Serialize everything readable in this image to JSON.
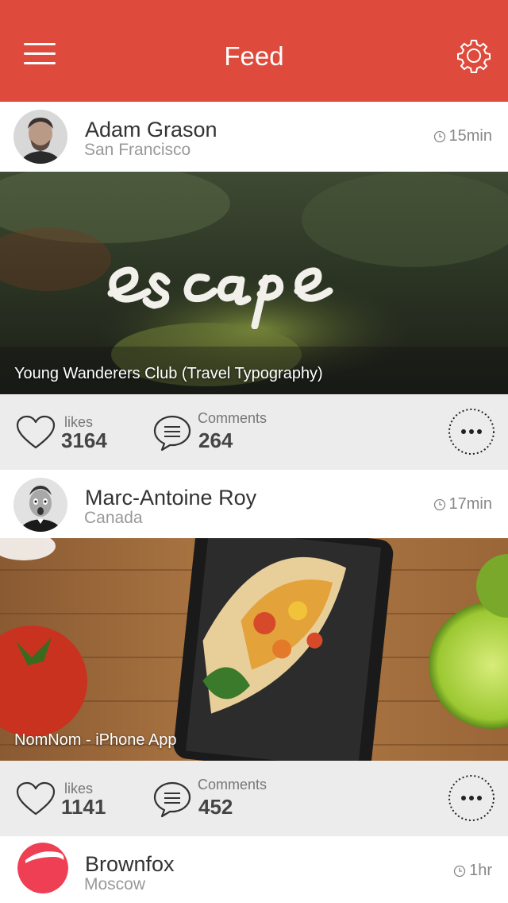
{
  "header": {
    "title": "Feed",
    "menu_icon": "hamburger-menu-icon",
    "settings_icon": "gear-icon",
    "color": "#de4b3c"
  },
  "posts": [
    {
      "author": "Adam Grason",
      "location": "San Francisco",
      "time": "15min",
      "caption": "Young Wanderers Club (Travel Typography)",
      "photo_text": "escape",
      "likes_label": "likes",
      "likes": "3164",
      "comments_label": "Comments",
      "comments": "264"
    },
    {
      "author": "Marc-Antoine Roy",
      "location": "Canada",
      "time": "17min",
      "caption": "NomNom - iPhone App",
      "likes_label": "likes",
      "likes": "1141",
      "comments_label": "Comments",
      "comments": "452"
    },
    {
      "author": "Brownfox",
      "location": "Moscow",
      "time": "1hr"
    }
  ]
}
